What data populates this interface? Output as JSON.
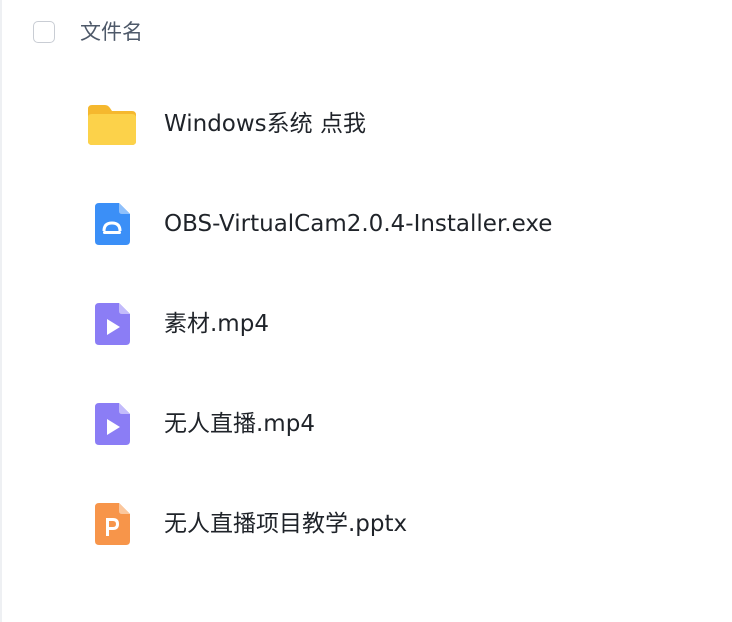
{
  "header": {
    "column_label": "文件名"
  },
  "files": [
    {
      "name": "Windows系统 点我",
      "icon": "folder-icon",
      "color": "#fbc63c"
    },
    {
      "name": "OBS-VirtualCam2.0.4-Installer.exe",
      "icon": "exe-file-icon",
      "color": "#3b8ff7"
    },
    {
      "name": "素材.mp4",
      "icon": "video-file-icon",
      "color": "#8b7df5"
    },
    {
      "name": "无人直播.mp4",
      "icon": "video-file-icon",
      "color": "#8b7df5"
    },
    {
      "name": "无人直播项目教学.pptx",
      "icon": "ppt-file-icon",
      "color": "#f7954a"
    }
  ]
}
